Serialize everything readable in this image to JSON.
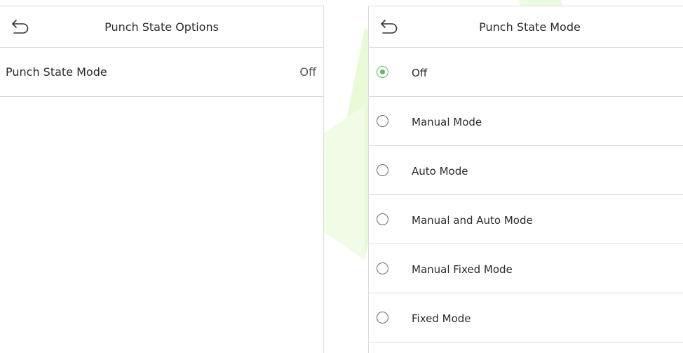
{
  "left_screen": {
    "title": "Punch State Options",
    "back_icon": "back-arrow-icon",
    "items": [
      {
        "label": "Punch State Mode",
        "value": "Off"
      }
    ]
  },
  "right_screen": {
    "title": "Punch State Mode",
    "back_icon": "back-arrow-icon",
    "selected": "Off",
    "options": [
      {
        "label": "Off",
        "selected": true
      },
      {
        "label": "Manual Mode",
        "selected": false
      },
      {
        "label": "Auto Mode",
        "selected": false
      },
      {
        "label": "Manual and Auto Mode",
        "selected": false
      },
      {
        "label": "Manual Fixed Mode",
        "selected": false
      },
      {
        "label": "Fixed Mode",
        "selected": false
      }
    ]
  },
  "colors": {
    "accent": "#5cb85c",
    "divider": "#dcdcdc",
    "watermark": "#ccf5a8"
  }
}
